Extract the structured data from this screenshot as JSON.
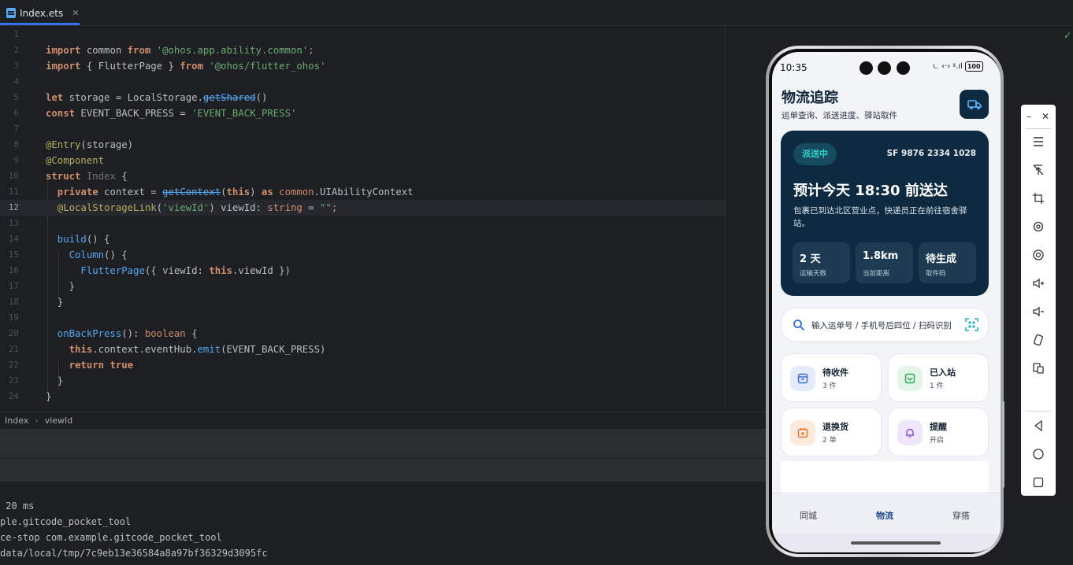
{
  "editor_tab": {
    "filename": "Index.ets",
    "close": "✕"
  },
  "code_lines": [
    {
      "n": "1"
    },
    {
      "n": "2"
    },
    {
      "n": "3"
    },
    {
      "n": "4"
    },
    {
      "n": "5"
    },
    {
      "n": "6"
    },
    {
      "n": "7"
    },
    {
      "n": "8"
    },
    {
      "n": "9"
    },
    {
      "n": "10"
    },
    {
      "n": "11"
    },
    {
      "n": "12"
    },
    {
      "n": "13"
    },
    {
      "n": "14"
    },
    {
      "n": "15"
    },
    {
      "n": "16"
    },
    {
      "n": "17"
    },
    {
      "n": "18"
    },
    {
      "n": "19"
    },
    {
      "n": "20"
    },
    {
      "n": "21"
    },
    {
      "n": "22"
    },
    {
      "n": "23"
    },
    {
      "n": "24"
    }
  ],
  "code": {
    "l2_a": "import",
    "l2_b": " common ",
    "l2_c": "from",
    "l2_d": " '@ohos.app.ability.common'",
    "l2_e": ";",
    "l3_a": "import",
    "l3_b": " { FlutterPage } ",
    "l3_c": "from",
    "l3_d": " '@ohos/flutter_ohos'",
    "l5_a": "let",
    "l5_b": " storage = LocalStorage.",
    "l5_c": "getShared",
    "l5_d": "()",
    "l6_a": "const",
    "l6_b": " EVENT_BACK_PRESS = ",
    "l6_c": "'EVENT_BACK_PRESS'",
    "l8_a": "@Entry",
    "l8_b": "(storage)",
    "l9_a": "@Component",
    "l10_a": "struct",
    "l10_b": " Index",
    "l10_c": " {",
    "l11_a": "  private",
    "l11_b": " context = ",
    "l11_c": "getContext",
    "l11_d": "(",
    "l11_e": "this",
    "l11_f": ") ",
    "l11_g": "as",
    "l11_h": " common",
    "l11_i": ".UIAbilityContext",
    "l12_a": "  @LocalStorageLink",
    "l12_b": "(",
    "l12_c": "'viewId'",
    "l12_d": ") viewId: ",
    "l12_e": "string",
    "l12_f": " = ",
    "l12_g": "\"\"",
    "l12_h": ";",
    "l14_a": "  build",
    "l14_b": "() {",
    "l15_a": "    Column",
    "l15_b": "() {",
    "l16_a": "      FlutterPage",
    "l16_b": "({ viewId: ",
    "l16_c": "this",
    "l16_d": ".viewId })",
    "l17_a": "    }",
    "l18_a": "  }",
    "l20_a": "  onBackPress",
    "l20_b": "(): ",
    "l20_c": "boolean",
    "l20_d": " {",
    "l21_a": "    this",
    "l21_b": ".context.eventHub.",
    "l21_c": "emit",
    "l21_d": "(EVENT_BACK_PRESS)",
    "l22_a": "    return",
    "l22_b": " true",
    "l23_a": "  }",
    "l24_a": "}"
  },
  "breadcrumb": {
    "item1": "Index",
    "sep": "›",
    "item2": "viewId"
  },
  "console": {
    "l1": " 20 ms",
    "l2": "ple.gitcode_pocket_tool",
    "l3": "ce-stop com.example.gitcode_pocket_tool",
    "l4": "data/local/tmp/7c9eb13e36584a8a97bf36329d3095fc"
  },
  "phone": {
    "status_time": "10:35",
    "status_icons": "⏾ ‹·› ᵡ.ıl",
    "battery": "100",
    "app_title": "物流追踪",
    "app_subtitle": "运单查询、派送进度、驿站取件",
    "hero": {
      "badge": "派送中",
      "tracking": "SF 9876 2334 1028",
      "eta": "预计今天 18:30 前送达",
      "desc": "包裹已到达北区营业点，快递员正在前往宿舍驿站。",
      "stats": [
        {
          "value": "2 天",
          "label": "运输天数"
        },
        {
          "value": "1.8km",
          "label": "当前距离"
        },
        {
          "value": "待生成",
          "label": "取件码"
        }
      ]
    },
    "search_placeholder": "输入运单号 / 手机号后四位 / 扫码识别",
    "tiles": [
      {
        "title": "待收件",
        "sub": "3 件"
      },
      {
        "title": "已入站",
        "sub": "1 件"
      },
      {
        "title": "退换货",
        "sub": "2 单"
      },
      {
        "title": "提醒",
        "sub": "开启"
      }
    ],
    "nav": [
      "同城",
      "物流",
      "穿搭"
    ]
  },
  "emulator": {
    "minimize": "–",
    "close": "✕"
  },
  "colors": {
    "accent": "#3574f0",
    "hero_bg": "#0d2a40",
    "badge_text": "#2fd6d0"
  }
}
